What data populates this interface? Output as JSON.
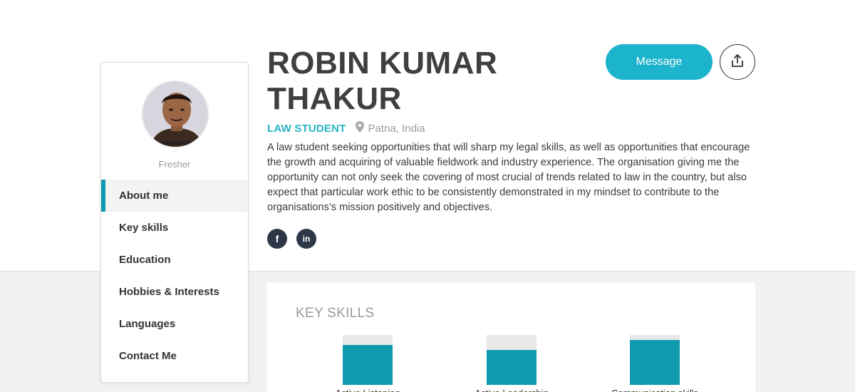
{
  "profile": {
    "name_line1": "ROBIN KUMAR",
    "name_line2": "THAKUR",
    "role": "LAW STUDENT",
    "location": "Patna, India",
    "status": "Fresher",
    "bio": "A law student seeking opportunities that will sharp my legal skills, as well as opportunities that encourage the growth and acquiring of valuable fieldwork and industry experience. The organisation giving me the opportunity can not only seek the covering of most crucial of trends related to law in the country, but also expect that particular work ethic to be consistently demonstrated in my mindset to contribute to the organisations’s mission positively and objectives."
  },
  "actions": {
    "message_label": "Message",
    "share_icon": "share-icon"
  },
  "social": [
    {
      "icon": "facebook-icon",
      "glyph": "f"
    },
    {
      "icon": "linkedin-icon",
      "glyph": "in"
    }
  ],
  "sidebar": {
    "items": [
      {
        "label": "About me",
        "active": true
      },
      {
        "label": "Key skills"
      },
      {
        "label": "Education"
      },
      {
        "label": "Hobbies & Interests"
      },
      {
        "label": "Languages"
      },
      {
        "label": "Contact Me"
      }
    ]
  },
  "skills": {
    "title": "KEY SKILLS",
    "items": [
      {
        "label": "Active Listening",
        "level": 0.8
      },
      {
        "label": "Active Leadership",
        "level": 0.7
      },
      {
        "label": "Communication skills",
        "level": 0.9
      }
    ]
  },
  "colors": {
    "accent": "#1bb4cc",
    "bar_fill": "#0e9aaf",
    "social_bg": "#2e3748"
  }
}
